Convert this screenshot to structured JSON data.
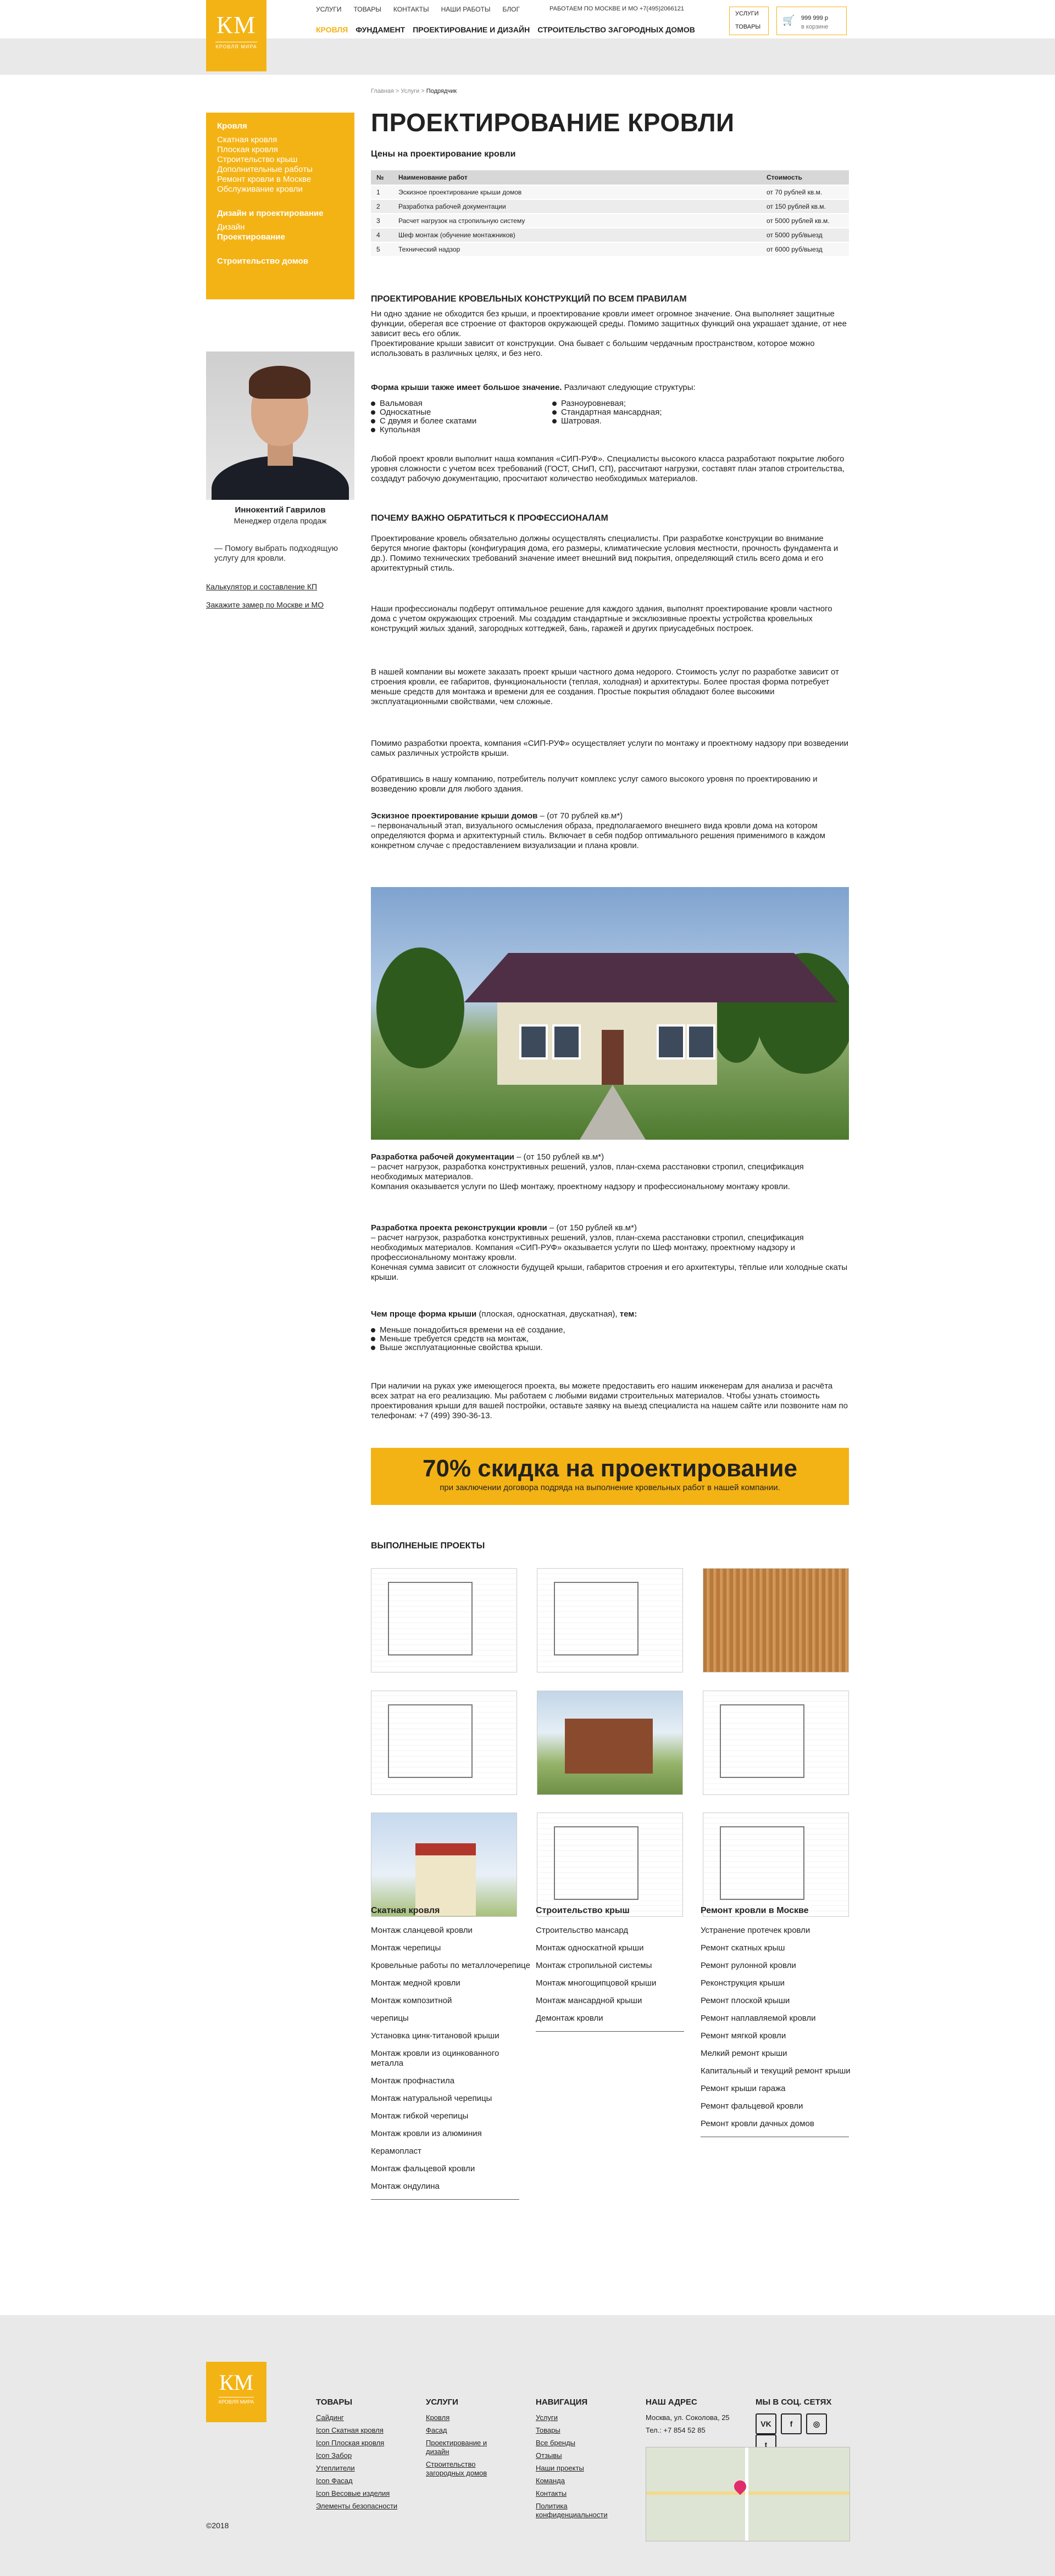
{
  "brand": {
    "logo": "КМ",
    "logo_sub": "КРОВЛЯ МИРА"
  },
  "header": {
    "top_nav": [
      "УСЛУГИ",
      "ТОВАРЫ",
      "КОНТАКТЫ",
      "НАШИ РАБОТЫ",
      "БЛОГ"
    ],
    "info": "РАБОТАЕМ ПО МОСКВЕ И МО   +7(495)2066121",
    "main_nav": [
      "КРОВЛЯ",
      "ФУНДАМЕНТ",
      "ПРОЕКТИРОВАНИЕ И ДИЗАЙН",
      "СТРОИТЕЛЬСТВО ЗАГОРОДНЫХ ДОМОВ"
    ],
    "btn_services": "УСЛУГИ",
    "btn_goods": "ТОВАРЫ",
    "cart_icon": "cart-icon",
    "cart_sum": "999 999 р",
    "cart_label": "в корзине"
  },
  "sidebar": {
    "section1": "Кровля",
    "items1": [
      "Скатная кровля",
      "Плоская кровля",
      "Строительство крыш",
      "Дополнительные работы",
      "Ремонт кровли в Москве",
      "Обслуживание кровли"
    ],
    "section2": "Дизайн и проектирование",
    "items2": [
      "Дизайн",
      "Проектирование"
    ],
    "section3": "Строительство домов"
  },
  "manager": {
    "name": "Иннокентий Гаврилов",
    "role": "Менеджер отдела продаж",
    "help": "— Помогу выбрать подходящую услугу для кровли.",
    "link1": "Калькулятор и составление КП",
    "link2": "Закажите замер по Москве и МО"
  },
  "breadcrumbs": [
    "Главная",
    "Услуги",
    "Подрядчик"
  ],
  "page_title": "ПРОЕКТИРОВАНИЕ КРОВЛИ",
  "prices": {
    "heading": "Цены на проектирование кровли",
    "columns": [
      "№",
      "Наименование работ",
      "Стоимость"
    ],
    "rows": [
      [
        "1",
        "Эскизное проектирование крыши домов",
        "от 70 рублей кв.м."
      ],
      [
        "2",
        "Разработка рабочей документации",
        "от 150 рублей кв.м."
      ],
      [
        "3",
        "Расчет нагрузок на стропильную систему",
        "от 5000 рублей кв.м."
      ],
      [
        "4",
        "Шеф монтаж (обучение монтажников)",
        "от 5000 руб/выезд"
      ],
      [
        "5",
        "Технический надзор",
        "от 6000 руб/выезд"
      ]
    ]
  },
  "sec1": {
    "heading": "ПРОЕКТИРОВАНИЕ КРОВЕЛЬНЫХ КОНСТРУКЦИЙ ПО ВСЕМ ПРАВИЛАМ",
    "p1": "Ни одно здание не обходится без крыши, и проектирование кровли имеет огромное значение. Она выполняет защитные функции, оберегая все строение от факторов окружающей среды. Помимо защитных функций она украшает здание, от нее зависит весь его облик.",
    "p2": "Проектирование крыши зависит от конструкции. Она бывает с большим чердачным пространством, которое можно использовать в различных целях, и без него.",
    "forms_lead": "Форма крыши также имеет большое значение.",
    "forms_rest": " Различают следующие структуры:",
    "forms_col1": [
      "Вальмовая",
      "Односкатные",
      "С двумя и более скатами",
      "Купольная"
    ],
    "forms_col2": [
      "Разноуровневая;",
      "Стандартная мансардная;",
      "Шатровая."
    ],
    "p3": "Любой проект кровли выполнит наша компания «СИП-РУФ». Специалисты высокого класса разработают покрытие любого уровня сложности с учетом всех требований (ГОСТ, СНиП, СП), рассчитают нагрузки, составят план этапов строительства, создадут рабочую документацию, просчитают количество необходимых материалов."
  },
  "sec2": {
    "heading": "ПОЧЕМУ ВАЖНО ОБРАТИТЬСЯ К ПРОФЕССИОНАЛАМ",
    "p1": "Проектирование кровель обязательно должны осуществлять специалисты. При разработке конструкции во внимание берутся многие факторы (конфигурация дома, его размеры, климатические условия местности, прочность фундамента и др.). Помимо технических требований значение имеет внешний вид покрытия, определяющий стиль всего дома и его архитектурный стиль.",
    "p2": "Наши профессионалы подберут оптимальное решение для каждого здания, выполнят проектирование кровли частного дома с учетом окружающих строений. Мы создадим стандартные и эксклюзивные проекты устройства кровельных конструкций жилых зданий, загородных коттеджей, бань, гаражей и других приусадебных построек.",
    "p3": "В нашей компании вы можете заказать проект крыши частного дома недорого. Стоимость услуг по разработке зависит от строения кровли, ее габаритов, функциональности (теплая, холодная) и архитектуры. Более простая форма потребует меньше средств для монтажа и времени для ее создания. Простые покрытия обладают более высокими эксплуатационными свойствами, чем сложные.",
    "p4": "Помимо разработки проекта, компания «СИП-РУФ» осуществляет услуги по монтажу и проектному надзору при возведении самых различных устройств крыши.",
    "p5": "Обратившись в нашу компанию, потребитель получит комплекс услуг самого высокого уровня по проектированию и возведению кровли для любого здания.",
    "sketch_bold": "Эскизное проектирование крыши домов",
    "sketch_price": " – (от 70 рублей кв.м*)",
    "sketch_text": "– первоначальный этап, визуального осмысления образа, предполагаемого внешнего вида кровли дома на котором определяются форма и архитектурный стиль. Включает в себя подбор оптимального решения применимого в каждом конкретном случае с предоставлением визуализации и плана кровли."
  },
  "sec3": {
    "docs_bold": "Разработка рабочей документации",
    "docs_price": " – (от 150 рублей кв.м*)",
    "docs_text": "– расчет нагрузок, разработка конструктивных решений, узлов, план-схема расстановки стропил, спецификация необходимых материалов.",
    "docs_text2": "Компания оказывается услуги по Шеф монтажу, проектному надзору и профессиональному монтажу кровли.",
    "recon_bold": "Разработка проекта реконструкции кровли",
    "recon_price": " – (от 150 рублей кв.м*)",
    "recon_text": "– расчет нагрузок, разработка конструктивных решений, узлов, план-схема расстановки стропил, спецификация необходимых материалов. Компания «СИП-РУФ» оказывается услуги по Шеф монтажу, проектному надзору и профессиональному монтажу кровли.",
    "recon_text2": "Конечная сумма зависит от сложности будущей крыши, габаритов строения и его архитектуры, тёплые или холодные скаты крыши.",
    "simple_bold1": "Чем проще форма крыши",
    "simple_mid": " (плоская, односкатная, двускатная),",
    "simple_bold2": " тем:",
    "simple_list": [
      "Меньше понадобиться времени на её создание,",
      "Меньше требуется средств на монтаж,",
      "Выше эксплуатационные свойства крыши."
    ],
    "final": "При наличии на руках уже имеющегося проекта, вы можете предоставить его нашим инженерам для анализа и расчёта всех затрат на его реализацию. Мы работаем с любыми видами строительных материалов. Чтобы узнать стоимость проектирования крыши для вашей постройки, оставьте заявку на выезд специалиста на нашем сайте или позвоните нам по телефонам: +7 (499) 390-36-13."
  },
  "discount": {
    "big": "70% скидка на проектирование",
    "small": "при заключении договора подряда на выполнение кровельных работ в нашей компании."
  },
  "projects_heading": "ВЫПОЛНЕНЫЕ ПРОЕКТЫ",
  "links": {
    "col1_title": "Скатная кровля",
    "col1": [
      "Монтаж сланцевой кровли",
      "Монтаж черепицы",
      "Кровельные работы по металлочерепице",
      "Монтаж медной кровли",
      "Монтаж композитной",
      "черепицы",
      "Установка цинк-титановой крыши",
      "Монтаж кровли из оцинкованного металла",
      "Монтаж профнастила",
      "Монтаж натуральной черепицы",
      "Монтаж гибкой черепицы",
      "Монтаж кровли из алюминия",
      "Керамопласт",
      "Монтаж фальцевой кровли",
      "Монтаж ондулина"
    ],
    "col2_title": "Строительство крыш",
    "col2": [
      "Строительство мансард",
      "Монтаж односкатной крыши",
      "Монтаж стропильной системы",
      "Монтаж многощипцовой крыши",
      "Монтаж мансардной крыши",
      "Демонтаж кровли"
    ],
    "col3_title": "Ремонт кровли в Москве",
    "col3": [
      "Устранение протечек кровли",
      "Ремонт скатных крыш",
      "Ремонт рулонной кровли",
      "Реконструкция крыши",
      "Ремонт плоской крыши",
      "Ремонт наплавляемой кровли",
      "Ремонт мягкой кровли",
      "Мелкий ремонт крыши",
      "Капитальный и текущий ремонт крыши",
      "Ремонт крыши гаража",
      "Ремонт фальцевой кровли",
      "Ремонт кровли дачных домов"
    ]
  },
  "footer": {
    "copyright": "©2018",
    "goods_title": "ТОВАРЫ",
    "goods": [
      "Сайдинг",
      "Icon Скатная кровля",
      "Icon Плоская кровля",
      "Icon Забор",
      "Утеплители",
      "Icon Фасад",
      "Icon Весовые изделия",
      "Элементы безопасности"
    ],
    "services_title": "УСЛУГИ",
    "services": [
      "Кровля",
      "Фасад",
      "Проектирование и дизайн",
      "Строительство загородных домов"
    ],
    "nav_title": "НАВИГАЦИЯ",
    "nav": [
      "Услуги",
      "Товары",
      "Все бренды",
      "Отзывы",
      "Наши проекты",
      "Команда",
      "Контакты",
      "Политика конфиденциальности"
    ],
    "addr_title": "НАШ АДРЕС",
    "address": "Москва, ул. Соколова, 25",
    "phone": "Тел.: +7 854 52 85",
    "social_title": "МЫ В СОЦ. СЕТЯХ",
    "social": [
      "VK",
      "f",
      "◎",
      "t"
    ]
  }
}
